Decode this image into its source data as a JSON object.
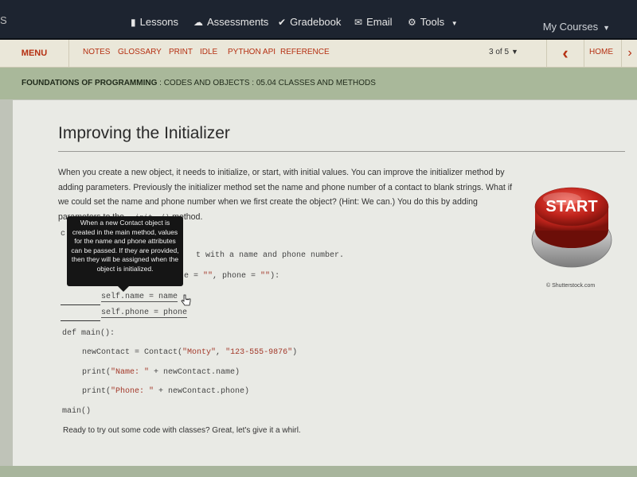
{
  "topbar": {
    "edge_text": "S",
    "nav": [
      {
        "icon": "book-icon",
        "label": "Lessons"
      },
      {
        "icon": "cloud-icon",
        "label": "Assessments"
      },
      {
        "icon": "check-icon",
        "label": "Gradebook"
      },
      {
        "icon": "envelope-icon",
        "label": "Email"
      },
      {
        "icon": "gear-icon",
        "label": "Tools"
      }
    ],
    "my_courses": "My Courses"
  },
  "subbar": {
    "menu": "MENU",
    "links": [
      "NOTES",
      "GLOSSARY",
      "PRINT",
      "IDLE",
      "PYTHON API",
      "REFERENCE"
    ],
    "pager": "3 of 5",
    "home": "HOME"
  },
  "breadcrumb": {
    "course": "FOUNDATIONS OF PROGRAMMING",
    "path": " : CODES AND OBJECTS : 05.04 CLASSES AND METHODS"
  },
  "lesson": {
    "title": "Improving the Initializer",
    "para_main": "When you create a new object, it needs to initialize, or start, with initial values. You can improve the initializer method by adding parameters. Previously the initializer method set the name and phone number of a contact to blank strings. What if we could set the name and phone number when we first create the object? (Hint: We can.) You do this by adding parameters to the ",
    "para_code": "__init__()",
    "para_end": " method.",
    "code": {
      "line_c": "c",
      "comment": "t with a name and phone number.",
      "params_1": "e = ",
      "params_str1": "\"\"",
      "params_2": ", phone = ",
      "params_str2": "\"\"",
      "params_3": "):",
      "assign_name": "self.name = name",
      "assign_phone": "self.phone = phone",
      "def_main": "def main():",
      "new_contact_1": "newContact = Contact(",
      "new_contact_arg1": "\"Monty\"",
      "new_contact_sep": ", ",
      "new_contact_arg2": "\"123-555-9876\"",
      "new_contact_2": ")",
      "print_name_1": "print(",
      "print_name_str": "\"Name: \"",
      "print_name_2": " + newContact.name)",
      "print_phone_1": "print(",
      "print_phone_str": "\"Phone: \"",
      "print_phone_2": " + newContact.phone)",
      "call_main": "main()"
    },
    "ending": "Ready to try out some code with classes? Great, let's give it a whirl."
  },
  "tooltip": {
    "text": "When a new Contact object is created in the main method, values for the name and phone attributes can be passed. If they are provided, then they will be assigned when the object is initialized."
  },
  "start_button": {
    "label": "START",
    "credit": "© Shutterstock.com"
  },
  "colors": {
    "accent": "#b53012",
    "topbar": "#1d2430",
    "breadcrumb_bg": "#a9b89a",
    "button_red": "#c0241c"
  }
}
